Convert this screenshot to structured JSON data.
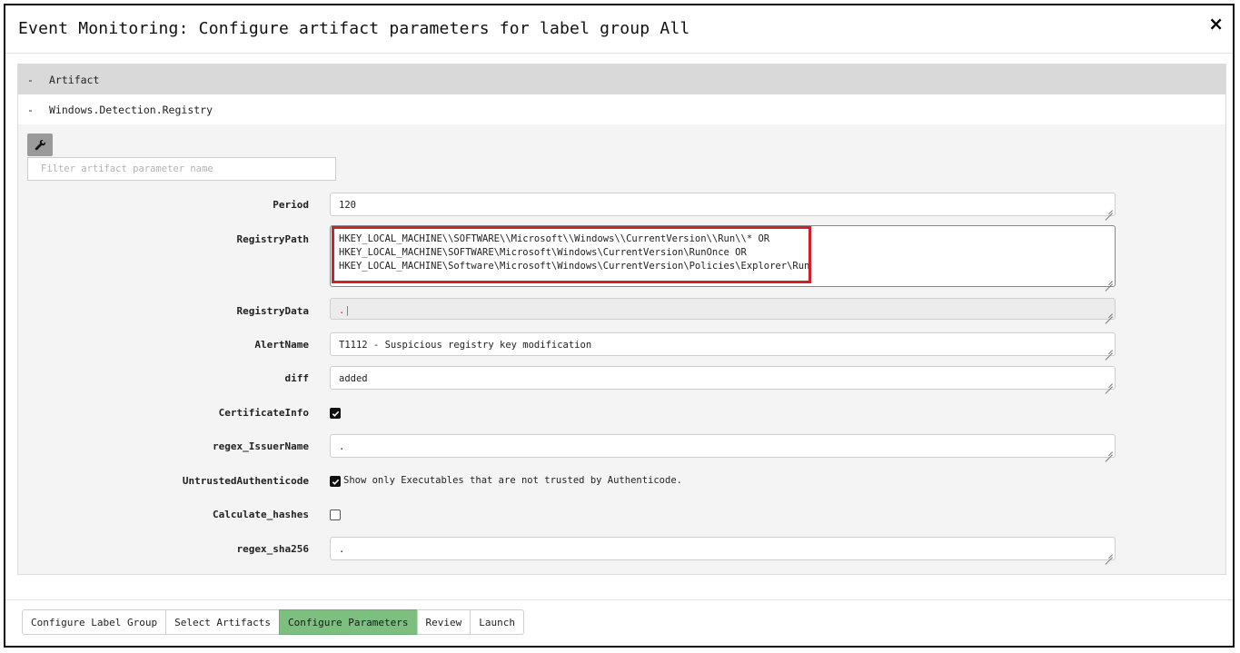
{
  "dialog": {
    "title": "Event Monitoring: Configure artifact parameters for label group All",
    "close_glyph": "×"
  },
  "tree": {
    "rows": [
      {
        "toggle": "-",
        "label": "Artifact"
      },
      {
        "toggle": "-",
        "label": "Windows.Detection.Registry"
      }
    ]
  },
  "filter": {
    "placeholder": "Filter artifact parameter name",
    "value": ""
  },
  "params": {
    "period": {
      "label": "Period",
      "value": "120"
    },
    "registry_path": {
      "label": "RegistryPath",
      "lines": [
        "HKEY_LOCAL_MACHINE\\\\SOFTWARE\\\\Microsoft\\\\Windows\\\\CurrentVersion\\\\Run\\\\* OR",
        "HKEY_LOCAL_MACHINE\\SOFTWARE\\Microsoft\\Windows\\CurrentVersion\\RunOnce OR",
        "HKEY_LOCAL_MACHINE\\Software\\Microsoft\\Windows\\CurrentVersion\\Policies\\Explorer\\Run"
      ]
    },
    "registry_data": {
      "label": "RegistryData",
      "value": "."
    },
    "alert_name": {
      "label": "AlertName",
      "value": "T1112 - Suspicious registry key modification"
    },
    "diff": {
      "label": "diff",
      "value": "added"
    },
    "certificate_info": {
      "label": "CertificateInfo",
      "checked": true
    },
    "regex_issuer": {
      "label": "regex_IssuerName",
      "value": "."
    },
    "untrusted": {
      "label": "UntrustedAuthenticode",
      "checked": true,
      "description": "Show only Executables that are not trusted by Authenticode."
    },
    "calculate_hashes": {
      "label": "Calculate_hashes",
      "checked": false
    },
    "regex_sha256": {
      "label": "regex_sha256",
      "value": "."
    }
  },
  "tabs": [
    {
      "label": "Configure Label Group",
      "active": false
    },
    {
      "label": "Select Artifacts",
      "active": false
    },
    {
      "label": "Configure Parameters",
      "active": true
    },
    {
      "label": "Review",
      "active": false
    },
    {
      "label": "Launch",
      "active": false
    }
  ],
  "icons": {
    "wrench": "wrench-icon",
    "check": "checkmark-icon"
  },
  "colors": {
    "active_tab": "#7cbf7f",
    "highlight": "#d0202a",
    "header_row": "#d9d9d9"
  }
}
